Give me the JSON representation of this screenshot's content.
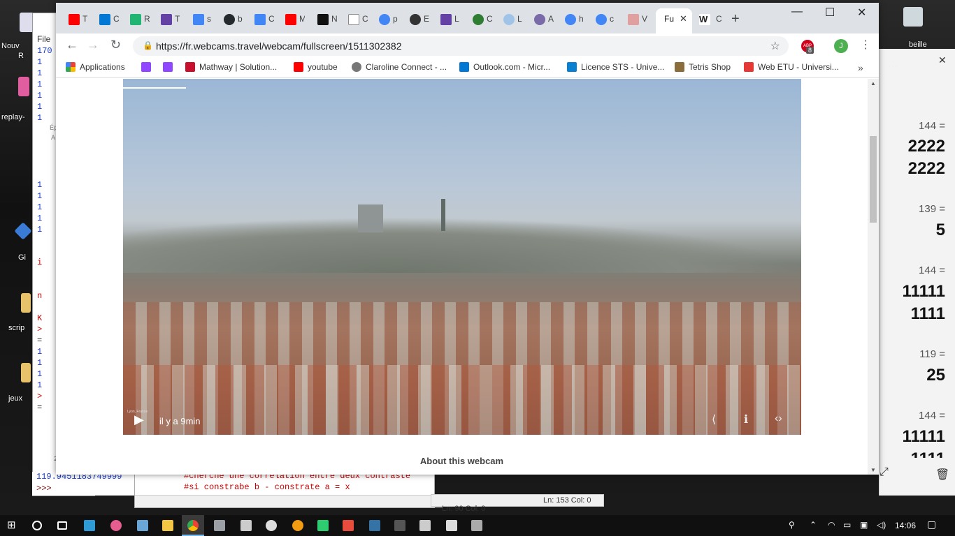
{
  "desktop": {
    "icons": [
      {
        "label": "Nouv",
        "sub": "R"
      },
      {
        "label": "replay-"
      },
      {
        "label": "Gi"
      },
      {
        "label": "scrip"
      },
      {
        "label": "jeux"
      },
      {
        "label": "beille"
      }
    ]
  },
  "shell": {
    "menu_file": "File",
    "lines": [
      "170",
      "1",
      "1",
      "1",
      "1",
      "1",
      "1",
      "1",
      "1",
      "1",
      "1",
      "1",
      "1",
      "1",
      "1",
      "1",
      "1"
    ],
    "fragment1": "Ép",
    "fragment2": "A",
    "red_i": "i",
    "red_n": "n",
    "red_k": "K",
    "prompt_gt": ">",
    "eq": "=",
    "bottom_value": "119.9451183749999",
    "prompt": ">>>",
    "line_num": "2"
  },
  "editor": {
    "code_line1": "#cherche une correlation entre deux contraste",
    "code_line2": "#si constrabe b - constrate a = x",
    "status": "Ln: 90   Col: 0",
    "status2": "Ln: 153   Col: 0"
  },
  "calculator": {
    "entries": [
      {
        "expr": "144 =",
        "result": "2222"
      },
      {
        "expr": "",
        "result": "2222"
      },
      {
        "expr": "139 =",
        "result": "5"
      },
      {
        "expr": "144 =",
        "result": "11111"
      },
      {
        "expr": "",
        "result": "1111"
      },
      {
        "expr": "119 =",
        "result": "25"
      },
      {
        "expr": "144 =",
        "result": "11111"
      },
      {
        "expr": "",
        "result": "1111"
      }
    ],
    "close": "✕",
    "trash": "🗑"
  },
  "chrome": {
    "tabs": [
      {
        "letter": "T",
        "color": "#ff0000"
      },
      {
        "letter": "C",
        "color": "#0078d4"
      },
      {
        "letter": "R",
        "color": "#21b573"
      },
      {
        "letter": "T",
        "color": "#6441a5"
      },
      {
        "letter": "s",
        "color": "#4285f4"
      },
      {
        "letter": "b",
        "color": "#24292e"
      },
      {
        "letter": "C",
        "color": "#4285f4"
      },
      {
        "letter": "M",
        "color": "#ff0000"
      },
      {
        "letter": "N",
        "color": "#111111"
      },
      {
        "letter": "C",
        "color": "#888888"
      },
      {
        "letter": "p",
        "color": "#4285f4"
      },
      {
        "letter": "E",
        "color": "#333333"
      },
      {
        "letter": "L",
        "color": "#6441a5"
      },
      {
        "letter": "C",
        "color": "#2e7d32"
      },
      {
        "letter": "L",
        "color": "#a0c4e8"
      },
      {
        "letter": "A",
        "color": "#7a6aa8"
      },
      {
        "letter": "h",
        "color": "#4285f4"
      },
      {
        "letter": "c",
        "color": "#4285f4"
      },
      {
        "letter": "V",
        "color": "#e0a0a0"
      }
    ],
    "active_tab": {
      "letter": "Fu",
      "close": "✕"
    },
    "after_tabs": [
      {
        "letter": "W",
        "color": "#222222"
      },
      {
        "letter": "C",
        "color": "#888888"
      }
    ],
    "new_tab": "+",
    "window_controls": {
      "minimize": "—",
      "maximize": "☐",
      "close": "✕"
    },
    "back": "←",
    "forward": "→",
    "reload": "↻",
    "url": "https://fr.webcams.travel/webcam/fullscreen/1511302382",
    "lock": "🔒",
    "star": "☆",
    "ext_label": "ABP",
    "ext_badge": "8",
    "avatar_letter": "J",
    "menu": "⋮",
    "bookmarks": [
      {
        "label": "Applications",
        "color": "#ea4335"
      },
      {
        "label": "",
        "color": "#9146ff"
      },
      {
        "label": "",
        "color": "#9146ff"
      },
      {
        "label": "Mathway | Solution...",
        "color": "#c8102e"
      },
      {
        "label": "youtube",
        "color": "#ff0000"
      },
      {
        "label": "Claroline Connect - ...",
        "color": "#777777"
      },
      {
        "label": "Outlook.com - Micr...",
        "color": "#0078d4"
      },
      {
        "label": "Licence STS - Unive...",
        "color": "#0a80d0"
      },
      {
        "label": "Tetris Shop",
        "color": "#8a6d3b"
      },
      {
        "label": "Web ETU - Universi...",
        "color": "#e53935"
      }
    ],
    "bookmarks_more": "»",
    "bookmarks_overflow": "···",
    "webcam": {
      "play": "▶",
      "time_ago": "il y a 9min",
      "caption": "Lyon, France",
      "share": "⟨",
      "info": "ℹ",
      "embed": "‹›"
    },
    "about": "About this webcam"
  },
  "taskbar": {
    "clock": "14:06",
    "apps": [
      {
        "name": "start",
        "color": "#ffffff"
      },
      {
        "name": "search",
        "color": "#ffffff"
      },
      {
        "name": "task-view",
        "color": "#ffffff"
      },
      {
        "name": "app-1",
        "color": "#2e9bd6"
      },
      {
        "name": "app-2",
        "color": "#e85d8f"
      },
      {
        "name": "notepad",
        "color": "#6aa7d6"
      },
      {
        "name": "explorer",
        "color": "#f3c744"
      },
      {
        "name": "chrome",
        "color": "#4caf50"
      },
      {
        "name": "app-3",
        "color": "#9aa0a6"
      },
      {
        "name": "app-4",
        "color": "#cccccc"
      },
      {
        "name": "app-5",
        "color": "#dddddd"
      },
      {
        "name": "app-6",
        "color": "#f39c12"
      },
      {
        "name": "app-7",
        "color": "#2ecc71"
      },
      {
        "name": "app-8",
        "color": "#e74c3c"
      },
      {
        "name": "python",
        "color": "#3572a5"
      },
      {
        "name": "terminal",
        "color": "#555555"
      },
      {
        "name": "photos",
        "color": "#cccccc"
      },
      {
        "name": "calculator",
        "color": "#dddddd"
      },
      {
        "name": "app-9",
        "color": "#aaaaaa"
      }
    ]
  }
}
